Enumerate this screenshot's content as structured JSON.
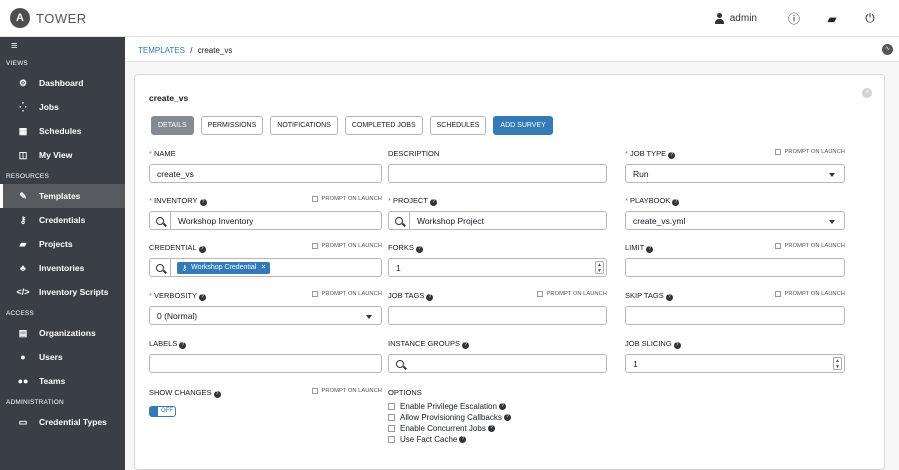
{
  "brand": {
    "logo_letter": "A",
    "name": "TOWER"
  },
  "topbar": {
    "username": "admin",
    "user_icon": "user-icon",
    "info_icon": "info-icon",
    "docs_icon": "book-icon",
    "logout_icon": "power-icon"
  },
  "sidebar": {
    "menu_icon": "hamburger-icon",
    "sections": [
      {
        "title": "VIEWS",
        "items": [
          {
            "label": "Dashboard",
            "icon": "dashboard-icon",
            "glyph": "⚙"
          },
          {
            "label": "Jobs",
            "icon": "jobs-spinner-icon",
            "glyph": "⁛"
          },
          {
            "label": "Schedules",
            "icon": "calendar-icon",
            "glyph": "▦"
          },
          {
            "label": "My View",
            "icon": "columns-icon",
            "glyph": "◫"
          }
        ]
      },
      {
        "title": "RESOURCES",
        "items": [
          {
            "label": "Templates",
            "icon": "edit-icon",
            "glyph": "✎",
            "active": true
          },
          {
            "label": "Credentials",
            "icon": "key-icon",
            "glyph": "⚷"
          },
          {
            "label": "Projects",
            "icon": "folder-icon",
            "glyph": "▰"
          },
          {
            "label": "Inventories",
            "icon": "sitemap-icon",
            "glyph": "♣"
          },
          {
            "label": "Inventory Scripts",
            "icon": "code-icon",
            "glyph": "</>"
          }
        ]
      },
      {
        "title": "ACCESS",
        "items": [
          {
            "label": "Organizations",
            "icon": "building-icon",
            "glyph": "▤"
          },
          {
            "label": "Users",
            "icon": "user-icon",
            "glyph": "●"
          },
          {
            "label": "Teams",
            "icon": "users-icon",
            "glyph": "●●"
          }
        ]
      },
      {
        "title": "ADMINISTRATION",
        "items": [
          {
            "label": "Credential Types",
            "icon": "id-card-icon",
            "glyph": "▭"
          }
        ]
      }
    ]
  },
  "breadcrumb": {
    "root": "TEMPLATES",
    "separator": "/",
    "current": "create_vs",
    "activity_icon": "activity-stream-icon"
  },
  "form": {
    "title": "create_vs",
    "tabs": {
      "details": "DETAILS",
      "permissions": "PERMISSIONS",
      "notifications": "NOTIFICATIONS",
      "completed_jobs": "COMPLETED JOBS",
      "schedules": "SCHEDULES",
      "add_survey": "ADD SURVEY"
    },
    "prompt_on_launch": "PROMPT ON LAUNCH",
    "name": {
      "label": "NAME",
      "value": "create_vs"
    },
    "description": {
      "label": "DESCRIPTION",
      "value": ""
    },
    "job_type": {
      "label": "JOB TYPE",
      "value": "Run"
    },
    "inventory": {
      "label": "INVENTORY",
      "value": "Workshop Inventory"
    },
    "project": {
      "label": "PROJECT",
      "value": "Workshop Project"
    },
    "playbook": {
      "label": "PLAYBOOK",
      "value": "create_vs.yml"
    },
    "credential": {
      "label": "CREDENTIAL",
      "chip": "Workshop Credential",
      "chip_remove": "×",
      "chip_icon": "⚷"
    },
    "forks": {
      "label": "FORKS",
      "value": "1"
    },
    "limit": {
      "label": "LIMIT",
      "value": ""
    },
    "verbosity": {
      "label": "VERBOSITY",
      "value": "0 (Normal)"
    },
    "job_tags": {
      "label": "JOB TAGS",
      "value": ""
    },
    "skip_tags": {
      "label": "SKIP TAGS",
      "value": ""
    },
    "labels": {
      "label": "LABELS",
      "value": ""
    },
    "instance_groups": {
      "label": "INSTANCE GROUPS",
      "value": ""
    },
    "job_slicing": {
      "label": "JOB SLICING",
      "value": "1"
    },
    "show_changes": {
      "label": "SHOW CHANGES",
      "toggle": "OFF"
    },
    "options": {
      "label": "OPTIONS",
      "items": [
        "Enable Privilege Escalation",
        "Allow Provisioning Callbacks",
        "Enable Concurrent Jobs",
        "Use Fact Cache"
      ]
    }
  },
  "colors": {
    "sidebar": "#393f44",
    "active_item": "#575b5f",
    "primary": "#337ab7",
    "required": "#d9534f",
    "selected_tab": "#848992"
  }
}
